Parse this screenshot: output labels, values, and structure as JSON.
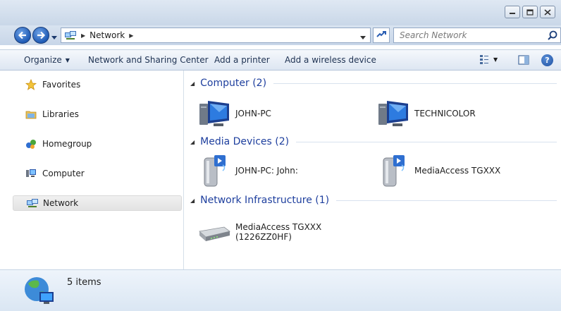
{
  "address": {
    "crumb": "Network"
  },
  "search": {
    "placeholder": "Search Network"
  },
  "toolbar": {
    "organize": "Organize",
    "network_sharing": "Network and Sharing Center",
    "add_printer": "Add a printer",
    "add_wireless": "Add a wireless device"
  },
  "sidebar": {
    "items": [
      {
        "label": "Favorites",
        "icon": "star-icon"
      },
      {
        "label": "Libraries",
        "icon": "library-icon"
      },
      {
        "label": "Homegroup",
        "icon": "homegroup-icon"
      },
      {
        "label": "Computer",
        "icon": "computer-icon"
      },
      {
        "label": "Network",
        "icon": "network-icon",
        "selected": true
      }
    ]
  },
  "groups": [
    {
      "title": "Computer (2)",
      "items": [
        {
          "label": "JOHN-PC",
          "icon": "computer-monitor-icon"
        },
        {
          "label": "TECHNICOLOR",
          "icon": "computer-monitor-icon"
        }
      ]
    },
    {
      "title": "Media Devices (2)",
      "items": [
        {
          "label": "JOHN-PC: John:",
          "icon": "media-device-icon"
        },
        {
          "label": "MediaAccess TGXXX",
          "icon": "media-device-icon"
        }
      ]
    },
    {
      "title": "Network Infrastructure (1)",
      "items": [
        {
          "label": "MediaAccess TGXXX",
          "label2": "(1226ZZ0HF)",
          "icon": "router-icon"
        }
      ]
    }
  ],
  "details": {
    "count": "5 items"
  },
  "colors": {
    "group_title": "#1e3f9e",
    "toolbar_text": "#1e3252"
  }
}
